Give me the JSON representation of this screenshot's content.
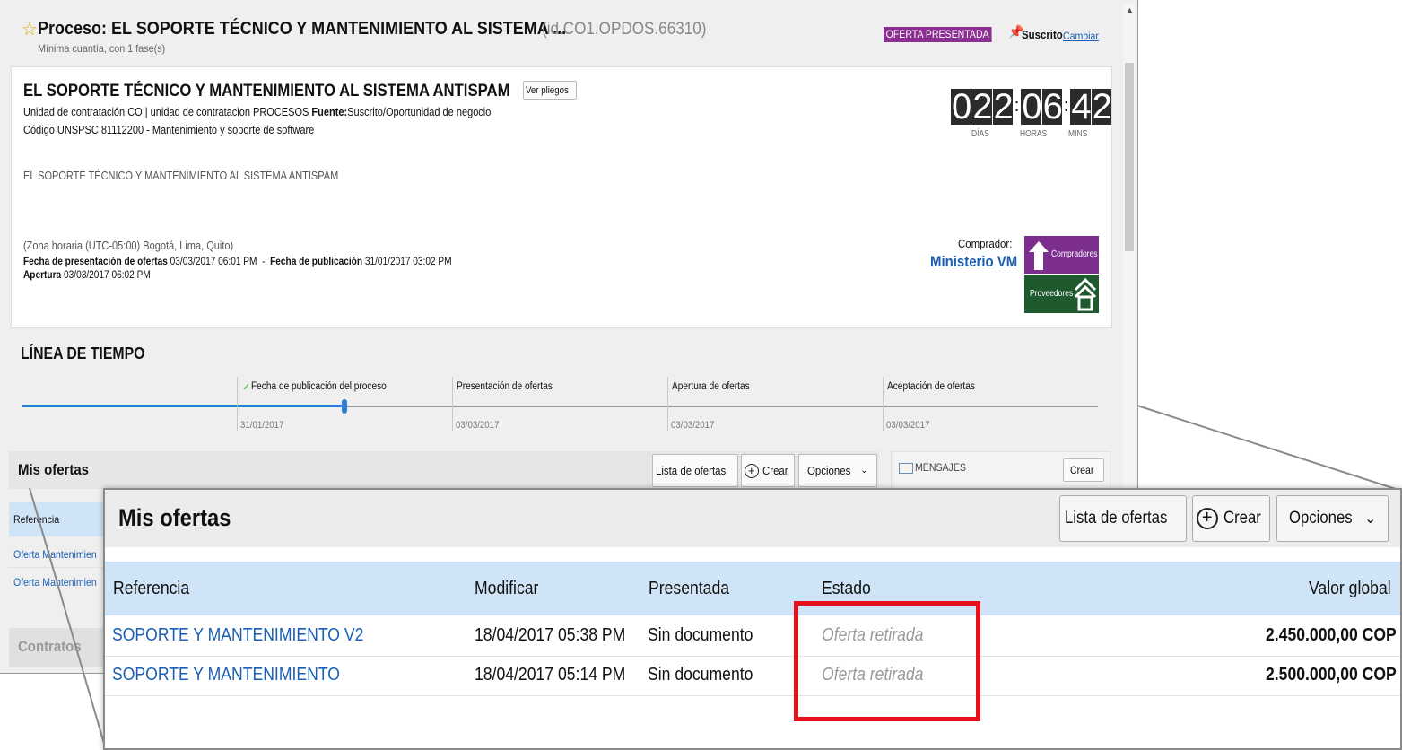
{
  "process": {
    "star": "☆",
    "title": "Proceso: EL SOPORTE TÉCNICO Y MANTENIMIENTO AL SISTEMA ...",
    "id": "(id.CO1.OPDOS.66310)",
    "subtitle": "Mínima cuantía, con 1 fase(s)",
    "status_badge": "OFERTA PRESENTADA",
    "subscribed": "Suscrito",
    "change_link": "Cambiar"
  },
  "detail": {
    "heading": "EL SOPORTE TÉCNICO Y MANTENIMIENTO AL SISTEMA ANTISPAM",
    "ver_pliegos": "Ver pliegos",
    "unit_line": "Unidad de contratación CO | unidad de contratacion PROCESOS",
    "fuente_label": "Fuente:",
    "fuente_value": "Suscrito/Oportunidad de negocio",
    "unspsc": "Código UNSPSC 81112200 - Mantenimiento y soporte de software",
    "description": "EL SOPORTE TÉCNICO Y MANTENIMIENTO AL SISTEMA ANTISPAM",
    "timezone": "(Zona horaria (UTC-05:00) Bogotá, Lima, Quito)",
    "fecha_presentacion_label": "Fecha de presentación de ofertas",
    "fecha_presentacion_value": "03/03/2017 06:01 PM",
    "sep": "-",
    "fecha_publicacion_label": "Fecha de publicación",
    "fecha_publicacion_value": "31/01/2017 03:02 PM",
    "apertura_label": "Apertura",
    "apertura_value": "03/03/2017 06:02 PM",
    "comprador_label": "Comprador:",
    "comprador_name": "Ministerio VM",
    "logo_top": "Compradores",
    "logo_bottom": "Proveedores"
  },
  "countdown": {
    "days_a": "0",
    "days_b": "2",
    "days_c": "2",
    "hours_a": "0",
    "hours_b": "6",
    "mins_a": "4",
    "mins_b": "2",
    "colon": ":",
    "days_label": "DÍAS",
    "hours_label": "HORAS",
    "mins_label": "MINS"
  },
  "timeline": {
    "title": "LÍNEA DE TIEMPO",
    "check": "✓",
    "stages": [
      {
        "label": "Fecha de publicación del proceso",
        "date": "31/01/2017"
      },
      {
        "label": "Presentación de ofertas",
        "date": "03/03/2017"
      },
      {
        "label": "Apertura de ofertas",
        "date": "03/03/2017"
      },
      {
        "label": "Aceptación de ofertas",
        "date": "03/03/2017"
      }
    ]
  },
  "bg_ofertas": {
    "title": "Mis ofertas",
    "lista": "Lista de ofertas",
    "crear": "Crear",
    "opciones": "Opciones",
    "ref_header": "Referencia",
    "row1": "Oferta Mantenimien",
    "row2": "Oferta Mantenimien",
    "contratos": "Contratos"
  },
  "mensajes": {
    "label": "MENSAJES",
    "crear": "Crear"
  },
  "zoom": {
    "title": "Mis ofertas",
    "lista": "Lista de ofertas",
    "crear": "Crear",
    "opciones": "Opciones",
    "columns": [
      "Referencia",
      "Modificar",
      "Presentada",
      "Estado",
      "Valor global"
    ],
    "rows": [
      {
        "ref": "SOPORTE Y MANTENIMIENTO V2",
        "modificar": "18/04/2017 05:38 PM",
        "presentada": "Sin documento",
        "estado": "Oferta retirada",
        "valor": "2.450.000,00 COP"
      },
      {
        "ref": "SOPORTE Y MANTENIMIENTO",
        "modificar": "18/04/2017 05:14 PM",
        "presentada": "Sin documento",
        "estado": "Oferta retirada",
        "valor": "2.500.000,00 COP"
      }
    ]
  },
  "colors": {
    "badge": "#8c2e92",
    "link": "#1a5fb4",
    "progress": "#2a7fd4",
    "highlight": "#e8101a",
    "table_header": "#cfe4f7",
    "logo_purple": "#7b2e8e",
    "logo_green": "#1f5a2f"
  }
}
